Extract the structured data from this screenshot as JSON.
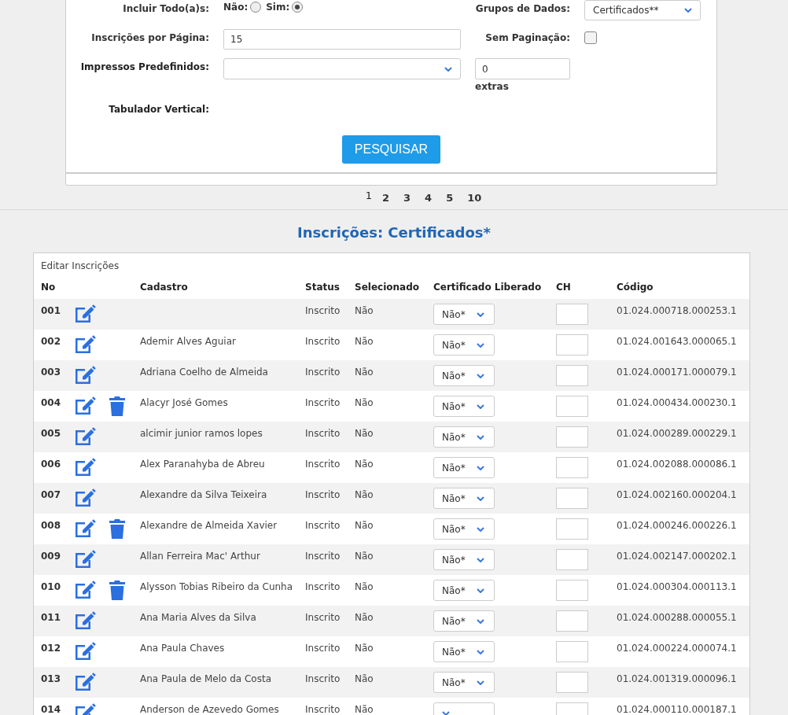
{
  "form": {
    "include_all": {
      "label": "Incluir Todo(a)s:",
      "options": [
        {
          "label": "Não:",
          "selected": false
        },
        {
          "label": "Sim:",
          "selected": true
        }
      ]
    },
    "data_groups": {
      "label": "Grupos de Dados:",
      "value": "Certificados**"
    },
    "per_page": {
      "label": "Inscrições por Página:",
      "value": "15"
    },
    "no_pagination": {
      "label": "Sem Paginação:",
      "checked": false
    },
    "preset_prints": {
      "label": "Impressos Predefinidos:"
    },
    "extras": {
      "value": "0",
      "label": "extras"
    },
    "vertical_tab": {
      "label": "Tabulador Vertical:"
    },
    "search_button": "PESQUISAR"
  },
  "pagination": [
    {
      "label": "1",
      "selected": true
    },
    {
      "label": "2",
      "selected": false
    },
    {
      "label": "3",
      "selected": false
    },
    {
      "label": "4",
      "selected": false
    },
    {
      "label": "5",
      "selected": false
    },
    {
      "label": "10",
      "selected": false
    }
  ],
  "section_title": "Inscrições: Certificados*",
  "table": {
    "caption": "Editar Inscrições",
    "columns": [
      "No",
      "Cadastro",
      "Status",
      "Selecionado",
      "Certificado Liberado",
      "CH",
      "Código"
    ],
    "rows": [
      {
        "no": "001",
        "status": "Inscrito",
        "selected_text": "Não",
        "released": "Não*",
        "code": "01.024.000718.000253.1",
        "deletable": false
      },
      {
        "no": "002",
        "name": "Ademir Alves Aguiar",
        "status": "Inscrito",
        "selected_text": "Não",
        "released": "Não*",
        "code": "01.024.001643.000065.1",
        "deletable": false
      },
      {
        "no": "003",
        "name": "Adriana Coelho de Almeida",
        "status": "Inscrito",
        "selected_text": "Não",
        "released": "Não*",
        "code": "01.024.000171.000079.1",
        "deletable": false
      },
      {
        "no": "004",
        "name": "Alacyr José Gomes",
        "status": "Inscrito",
        "selected_text": "Não",
        "released": "Não*",
        "code": "01.024.000434.000230.1",
        "deletable": true
      },
      {
        "no": "005",
        "name": "alcimir junior ramos lopes",
        "status": "Inscrito",
        "selected_text": "Não",
        "released": "Não*",
        "code": "01.024.000289.000229.1",
        "deletable": false
      },
      {
        "no": "006",
        "name": "Alex Paranahyba de Abreu",
        "status": "Inscrito",
        "selected_text": "Não",
        "released": "Não*",
        "code": "01.024.002088.000086.1",
        "deletable": false
      },
      {
        "no": "007",
        "name": "Alexandre da Silva Teixeira",
        "status": "Inscrito",
        "selected_text": "Não",
        "released": "Não*",
        "code": "01.024.002160.000204.1",
        "deletable": false
      },
      {
        "no": "008",
        "name": "Alexandre de Almeida Xavier",
        "status": "Inscrito",
        "selected_text": "Não",
        "released": "Não*",
        "code": "01.024.000246.000226.1",
        "deletable": true
      },
      {
        "no": "009",
        "name": "Allan Ferreira Mac' Arthur",
        "status": "Inscrito",
        "selected_text": "Não",
        "released": "Não*",
        "code": "01.024.002147.000202.1",
        "deletable": false
      },
      {
        "no": "010",
        "name": "Alysson Tobias Ribeiro da Cunha",
        "status": "Inscrito",
        "selected_text": "Não",
        "released": "Não*",
        "code": "01.024.000304.000113.1",
        "deletable": true
      },
      {
        "no": "011",
        "name": "Ana Maria Alves da Silva",
        "status": "Inscrito",
        "selected_text": "Não",
        "released": "Não*",
        "code": "01.024.000288.000055.1",
        "deletable": false
      },
      {
        "no": "012",
        "name": "Ana Paula Chaves",
        "status": "Inscrito",
        "selected_text": "Não",
        "released": "Não*",
        "code": "01.024.000224.000074.1",
        "deletable": false
      },
      {
        "no": "013",
        "name": "Ana Paula de Melo da Costa",
        "status": "Inscrito",
        "selected_text": "Não",
        "released": "Não*",
        "code": "01.024.001319.000096.1",
        "deletable": false
      },
      {
        "no": "014",
        "name": "Anderson de Azevedo Gomes",
        "status": "Inscrito",
        "selected_text": "Não",
        "code": "01.024.000110.000187.1",
        "deletable": false
      }
    ]
  }
}
